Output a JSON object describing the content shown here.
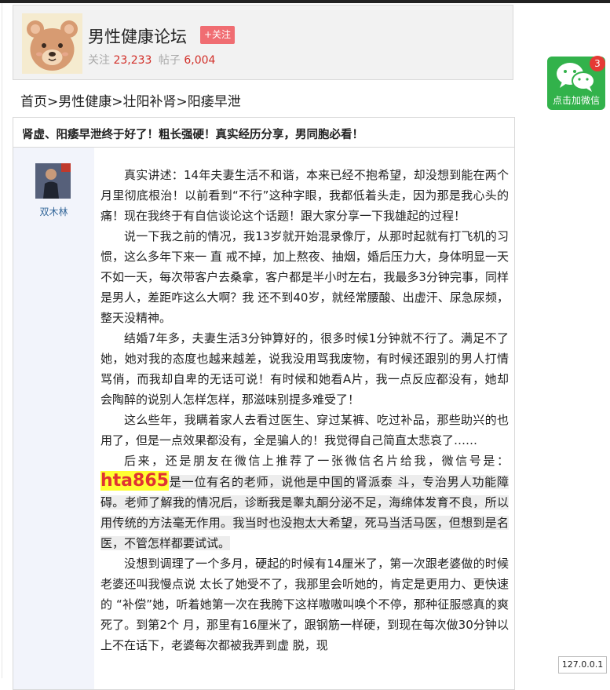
{
  "forum": {
    "name": "男性健康论坛",
    "follow_label": "+关注",
    "follow_stat_label": "关注",
    "follow_count": "23,233",
    "posts_stat_label": "帖子",
    "posts_count": "6,004"
  },
  "breadcrumb": [
    "首页",
    ">",
    "男性健康",
    ">",
    "壮阳补肾",
    ">",
    "阳痿早泄"
  ],
  "post": {
    "title": "肾虚、阳痿早泄终于好了！粗长强硬！真实经历分享，男同胞必看！",
    "author": "双木林",
    "p1": "真实讲述：14年夫妻生活不和谐，本来已经不抱希望，却没想到能在两个月里彻底根治！以前看到“不行”这种字眼，我都低着头走，因为那是我心头的痛！现在我终于有自信谈论这个话题！跟大家分享一下我雄起的过程！",
    "p2": "说一下我之前的情况，我13岁就开始混录像厅，从那时起就有打飞机的习惯，这么多年下来一 直 戒不掉，加上熬夜、抽烟，婚后压力大，身体明显一天不如一天，每次带客户去桑拿，客户都是半小时左右，我最多3分钟完事，同样是男人，差距咋这么大啊？我 还不到40岁，就经常腰酸、出虚汗、尿急尿频，整天没精神。",
    "p3": "结婚7年多，夫妻生活3分钟算好的，很多时候1分钟就不行了。满足不了她，她对我的态度也越来越差，说我没用骂我废物，有时候还跟别的男人打情骂俏，而我却自卑的无话可说！有时候和她看A片，我一点反应都没有，她却会陶醉的说别人怎样怎样，那滋味别提多难受了！",
    "p4": "这么些年，我瞒着家人去看过医生、穿过某裤、吃过补品，那些助兴的也用了，但是一点效果都没有，全是骗人的！我觉得自己简直太悲哀了……",
    "p5a": "后来，还是朋友在微信上推荐了一张微信名片给我，微信号是：",
    "wechat_id": "hta865",
    "p5b": "是一位有名的老师，说他是中国的肾派泰 斗，专治男人功能障碍。老师了解我的情况后，诊断我是睾丸酮分泌不足，海绵体发育不良，所以用传统的方法毫无作用。我当时也没抱太大希望，死马当活马医，但想到是名医，不管怎样都要试试。",
    "p6": "没想到调理了一个多月，硬起的时候有14厘米了，第一次跟老婆做的时候老婆还叫我慢点说 太长了她受不了，我那里会听她的，肯定是更用力、更快速的 “补偿”她，听着她第一次在我胯下这样嗷嗷叫唤个不停，那种征服感真的爽死了。到第2个 月，那里有16厘米了，跟钢筋一样硬，到现在每次做30分钟以上不在话下，老婆每次都被我弄到虚 脱，现"
  },
  "wechat_float": {
    "label": "点击加微信",
    "badge": "3"
  },
  "ip": "127.0.0.1"
}
